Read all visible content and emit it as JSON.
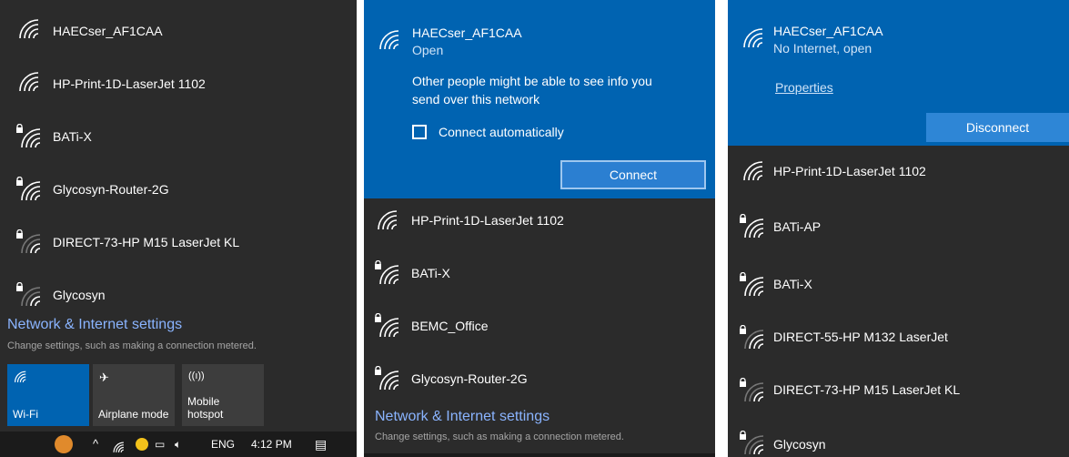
{
  "panel1": {
    "networks": [
      {
        "name": "HAECser_AF1CAA",
        "secured": false
      },
      {
        "name": "HP-Print-1D-LaserJet 1102",
        "secured": false
      },
      {
        "name": "BATi-X",
        "secured": true
      },
      {
        "name": "Glycosyn-Router-2G",
        "secured": true
      },
      {
        "name": "DIRECT-73-HP M15 LaserJet KL",
        "secured": true
      },
      {
        "name": "Glycosyn",
        "secured": true
      }
    ],
    "settings_link": "Network & Internet settings",
    "settings_desc": "Change settings, such as making a connection metered.",
    "tiles": [
      {
        "label": "Wi-Fi",
        "icon": "wifi-icon",
        "active": true
      },
      {
        "label": "Airplane mode",
        "icon": "airplane-icon",
        "active": false
      },
      {
        "label_line1": "Mobile",
        "label_line2": "hotspot",
        "icon": "hotspot-icon",
        "active": false
      }
    ],
    "taskbar": {
      "language": "ENG",
      "time": "4:12 PM",
      "chevron": "^"
    }
  },
  "panel2": {
    "expanded": {
      "name": "HAECser_AF1CAA",
      "status": "Open",
      "warning_line1": "Other people might be able to see info you",
      "warning_line2": "send over this network",
      "checkbox_label": "Connect automatically",
      "connect_label": "Connect"
    },
    "networks": [
      {
        "name": "HP-Print-1D-LaserJet 1102",
        "secured": false
      },
      {
        "name": "BATi-X",
        "secured": true
      },
      {
        "name": "BEMC_Office",
        "secured": true
      },
      {
        "name": "Glycosyn-Router-2G",
        "secured": true
      }
    ],
    "settings_link": "Network & Internet settings",
    "settings_desc": "Change settings, such as making a connection metered."
  },
  "panel3": {
    "expanded": {
      "name": "HAECser_AF1CAA",
      "status": "No Internet, open",
      "properties_label": "Properties",
      "disconnect_label": "Disconnect"
    },
    "networks": [
      {
        "name": "HP-Print-1D-LaserJet 1102",
        "secured": false
      },
      {
        "name": "BATi-AP",
        "secured": true
      },
      {
        "name": "BATi-X",
        "secured": true
      },
      {
        "name": "DIRECT-55-HP M132 LaserJet",
        "secured": true
      },
      {
        "name": "DIRECT-73-HP M15 LaserJet KL",
        "secured": true
      },
      {
        "name": "Glycosyn",
        "secured": true
      }
    ]
  },
  "colors": {
    "panel_bg": "#2b2b2b",
    "accent": "#0063b1",
    "link": "#8ab4ff",
    "taskbar": "#1b1b1b"
  }
}
